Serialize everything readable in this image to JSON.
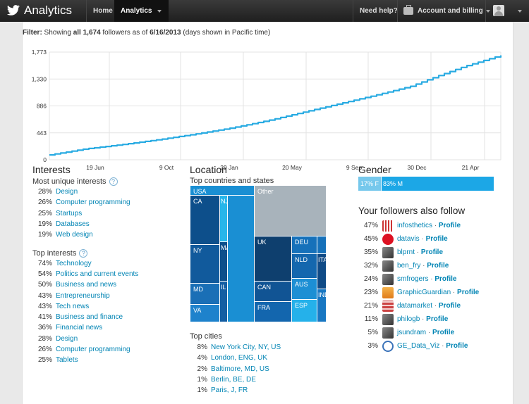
{
  "header": {
    "brand": "Analytics",
    "nav": {
      "home": "Home",
      "analytics": "Analytics",
      "help": "Need help?",
      "account": "Account and billing"
    }
  },
  "filter": {
    "label": "Filter:",
    "text_before": " Showing ",
    "emphasis": "all 1,674",
    "text_mid": " followers as of ",
    "date": "6/16/2013",
    "text_after": " (days shown in Pacific time)"
  },
  "chart_data": {
    "type": "line",
    "title": "",
    "yticks": [
      "1,773",
      "1,330",
      "886",
      "443",
      "0"
    ],
    "ylim": [
      0,
      1773
    ],
    "xticks": [
      "19 Jun",
      "9 Oct",
      "29 Jan",
      "20 May",
      "9 Sep",
      "30 Dec",
      "21 Apr"
    ],
    "series": [
      {
        "color": "#29abe2",
        "x": [
          0,
          0.08,
          0.16,
          0.24,
          0.32,
          0.4,
          0.48,
          0.56,
          0.64,
          0.72,
          0.8,
          0.86,
          0.92,
          1.0
        ],
        "values": [
          80,
          180,
          250,
          330,
          420,
          520,
          640,
          780,
          920,
          1060,
          1210,
          1380,
          1540,
          1720
        ]
      }
    ],
    "grid": true
  },
  "interests": {
    "title": "Interests",
    "unique_title": "Most unique interests",
    "unique": [
      {
        "pct": "28%",
        "label": "Design"
      },
      {
        "pct": "26%",
        "label": "Computer programming"
      },
      {
        "pct": "25%",
        "label": "Startups"
      },
      {
        "pct": "19%",
        "label": "Databases"
      },
      {
        "pct": "19%",
        "label": "Web design"
      }
    ],
    "top_title": "Top interests",
    "top": [
      {
        "pct": "74%",
        "label": "Technology"
      },
      {
        "pct": "54%",
        "label": "Politics and current events"
      },
      {
        "pct": "50%",
        "label": "Business and news"
      },
      {
        "pct": "43%",
        "label": "Entrepreneurship"
      },
      {
        "pct": "43%",
        "label": "Tech news"
      },
      {
        "pct": "41%",
        "label": "Business and finance"
      },
      {
        "pct": "36%",
        "label": "Financial news"
      },
      {
        "pct": "28%",
        "label": "Design"
      },
      {
        "pct": "26%",
        "label": "Computer programming"
      },
      {
        "pct": "25%",
        "label": "Tablets"
      }
    ]
  },
  "location": {
    "title": "Location",
    "countries_title": "Top countries and states",
    "treemap": [
      {
        "label": "USA",
        "color": "#1a8fd3"
      },
      {
        "label": "CA",
        "color": "#0d4f8b"
      },
      {
        "label": "NY",
        "color": "#115a9c"
      },
      {
        "label": "MD",
        "color": "#1a6fb6"
      },
      {
        "label": "VA",
        "color": "#1e82cc"
      },
      {
        "label": "NJ",
        "color": "#27b6ea"
      },
      {
        "label": "MA",
        "color": "#0d4f8b"
      },
      {
        "label": "IL",
        "color": "#145ea3"
      },
      {
        "label": "Other",
        "color": "#a8b3bb"
      },
      {
        "label": "UK",
        "color": "#0e3f6e"
      },
      {
        "label": "CAN",
        "color": "#115494"
      },
      {
        "label": "FRA",
        "color": "#1366ae"
      },
      {
        "label": "DEU",
        "color": "#1671ba"
      },
      {
        "label": "NLD",
        "color": "#1467ae"
      },
      {
        "label": "AUS",
        "color": "#1d8fd4"
      },
      {
        "label": "ESP",
        "color": "#25b1ea"
      },
      {
        "label": "ITA",
        "color": "#0f4a86"
      },
      {
        "label": "IND",
        "color": "#1877c2"
      }
    ],
    "cities_title": "Top cities",
    "cities": [
      {
        "pct": "8%",
        "label": "New York City, NY, US"
      },
      {
        "pct": "4%",
        "label": "London, ENG, UK"
      },
      {
        "pct": "2%",
        "label": "Baltimore, MD, US"
      },
      {
        "pct": "1%",
        "label": "Berlin, BE, DE"
      },
      {
        "pct": "1%",
        "label": "Paris, J, FR"
      }
    ]
  },
  "gender": {
    "title": "Gender",
    "female": "17% F",
    "male": "83% M",
    "female_share": 0.17,
    "colors": {
      "female": "#76c8ec",
      "male": "#1ca7e6"
    }
  },
  "also_follow": {
    "title": "Your followers also follow",
    "profile_label": "Profile",
    "items": [
      {
        "pct": "47%",
        "handle": "infosthetics",
        "icon": "bar-chart-avatar"
      },
      {
        "pct": "45%",
        "handle": "datavis",
        "icon": "red-circle-avatar"
      },
      {
        "pct": "35%",
        "handle": "blprnt",
        "icon": "photo-avatar"
      },
      {
        "pct": "32%",
        "handle": "ben_fry",
        "icon": "photo-avatar"
      },
      {
        "pct": "24%",
        "handle": "smfrogers",
        "icon": "photo-avatar"
      },
      {
        "pct": "23%",
        "handle": "GraphicGuardian",
        "icon": "orange-avatar"
      },
      {
        "pct": "21%",
        "handle": "datamarket",
        "icon": "red-grid-avatar"
      },
      {
        "pct": "11%",
        "handle": "philogb",
        "icon": "photo-avatar"
      },
      {
        "pct": "5%",
        "handle": "jsundram",
        "icon": "photo-avatar"
      },
      {
        "pct": "3%",
        "handle": "GE_Data_Viz",
        "icon": "ge-logo-avatar"
      }
    ]
  }
}
